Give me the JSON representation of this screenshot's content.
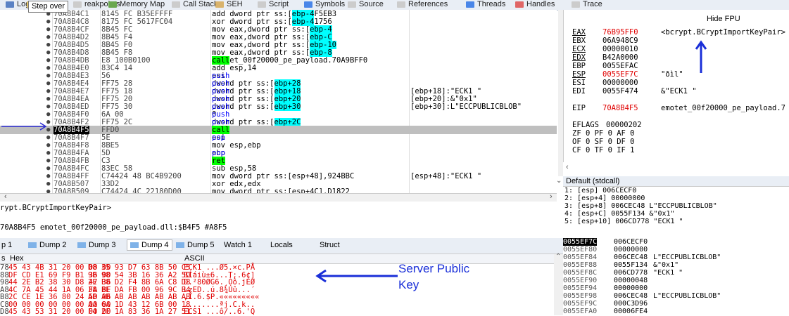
{
  "tabs": [
    {
      "label": "Log",
      "color": "#5b82c4"
    },
    {
      "label": "Not",
      "color": "#e3c46a"
    },
    {
      "label": "reakpoints",
      "color": "#cccccc"
    },
    {
      "label": "Memory Map",
      "color": "#6aa84f"
    },
    {
      "label": "Call Stack",
      "color": "#cccccc"
    },
    {
      "label": "SEH",
      "color": "#d9b36c"
    },
    {
      "label": "Script",
      "color": "#cccccc"
    },
    {
      "label": "Symbols",
      "color": "#4a86e8"
    },
    {
      "label": "Source",
      "color": "#cccccc"
    },
    {
      "label": "References",
      "color": "#cccccc"
    },
    {
      "label": "Threads",
      "color": "#4a86e8"
    },
    {
      "label": "Handles",
      "color": "#e06666"
    },
    {
      "label": "Trace",
      "color": "#cccccc"
    }
  ],
  "tooltip": "Step over",
  "disasm": [
    {
      "addr": "70A8B4C1",
      "bytes": "8145 FC B35EFFFF",
      "instr": "add dword ptr ss:[ebp-4],FFFF5EB3",
      "cmt": ""
    },
    {
      "addr": "70A8B4C8",
      "bytes": "8175 FC 5617FC04",
      "instr": "xor dword ptr ss:[ebp-4],4FC1756",
      "cmt": ""
    },
    {
      "addr": "70A8B4CF",
      "bytes": "8B45 FC",
      "instr": "mov eax,dword ptr ss:[ebp-4]",
      "cmt": ""
    },
    {
      "addr": "70A8B4D2",
      "bytes": "8B45 F4",
      "instr": "mov eax,dword ptr ss:[ebp-C]",
      "cmt": ""
    },
    {
      "addr": "70A8B4D5",
      "bytes": "8B45 F0",
      "instr": "mov eax,dword ptr ss:[ebp-10]",
      "cmt": ""
    },
    {
      "addr": "70A8B4D8",
      "bytes": "8B45 F8",
      "instr": "mov eax,dword ptr ss:[ebp-8]",
      "cmt": ""
    },
    {
      "addr": "70A8B4DB",
      "bytes": "E8 100B0100",
      "instr": "call emotet_00f20000_pe_payload.70A9BFF0",
      "cmt": ""
    },
    {
      "addr": "70A8B4E0",
      "bytes": "83C4 14",
      "instr": "add esp,14",
      "cmt": ""
    },
    {
      "addr": "70A8B4E3",
      "bytes": "56",
      "instr": "push esi",
      "cmt": ""
    },
    {
      "addr": "70A8B4E4",
      "bytes": "FF75 28",
      "instr": "push dword ptr ss:[ebp+28]",
      "cmt": ""
    },
    {
      "addr": "70A8B4E7",
      "bytes": "FF75 18",
      "instr": "push dword ptr ss:[ebp+18]",
      "cmt": "[ebp+18]:\"ECK1 \""
    },
    {
      "addr": "70A8B4EA",
      "bytes": "FF75 20",
      "instr": "push dword ptr ss:[ebp+20]",
      "cmt": "[ebp+20]:&\"0x1\""
    },
    {
      "addr": "70A8B4ED",
      "bytes": "FF75 30",
      "instr": "push dword ptr ss:[ebp+30]",
      "cmt": "[ebp+30]:L\"ECCPUBLICBLOB\""
    },
    {
      "addr": "70A8B4F0",
      "bytes": "6A 00",
      "instr": "push 0",
      "cmt": ""
    },
    {
      "addr": "70A8B4F2",
      "bytes": "FF75 2C",
      "instr": "push dword ptr ss:[ebp+2C]",
      "cmt": ""
    },
    {
      "addr": "70A8B4F5",
      "bytes": "FFD0",
      "instr": "call eax",
      "cmt": ""
    },
    {
      "addr": "70A8B4F7",
      "bytes": "5E",
      "instr": "pop esi",
      "cmt": ""
    },
    {
      "addr": "70A8B4F8",
      "bytes": "8BE5",
      "instr": "mov esp,ebp",
      "cmt": ""
    },
    {
      "addr": "70A8B4FA",
      "bytes": "5D",
      "instr": "pop ebp",
      "cmt": ""
    },
    {
      "addr": "70A8B4FB",
      "bytes": "C3",
      "instr": "ret",
      "cmt": ""
    },
    {
      "addr": "70A8B4FC",
      "bytes": "83EC 58",
      "instr": "sub esp,58",
      "cmt": ""
    },
    {
      "addr": "70A8B4FF",
      "bytes": "C74424 48 BC4B9200",
      "instr": "mov dword ptr ss:[esp+48],924BBC",
      "cmt": "[esp+48]:\"ECK1 \""
    },
    {
      "addr": "70A8B507",
      "bytes": "33D2",
      "instr": "xor edx,edx",
      "cmt": ""
    },
    {
      "addr": "70A8B509",
      "bytes": "C74424 4C 22180D00",
      "instr": "mov dword ptr ss:[esp+4C],D1822",
      "cmt": ""
    }
  ],
  "info_line1": "rypt.BCryptImportKeyPair>",
  "info_line2": "70A8B4F5 emotet_00f20000_pe_payload.dll:$B4F5 #A8F5",
  "registers": {
    "hide_fpu": "Hide FPU",
    "rows": [
      {
        "n": "EAX",
        "v": "76B95FF0",
        "c": "<bcrypt.BCryptImportKeyPair>"
      },
      {
        "n": "EBX",
        "v": "06A948C9",
        "c": ""
      },
      {
        "n": "ECX",
        "v": "00000010",
        "c": ""
      },
      {
        "n": "EDX",
        "v": "B42A0000",
        "c": ""
      },
      {
        "n": "EBP",
        "v": "0055EFAC",
        "c": ""
      },
      {
        "n": "ESP",
        "v": "0055EF7C",
        "c": "\"ðìl\""
      },
      {
        "n": "ESI",
        "v": "00000000",
        "c": ""
      },
      {
        "n": "EDI",
        "v": "0055F474",
        "c": "&\"ECK1 \""
      },
      {
        "n": "EIP",
        "v": "70A8B4F5",
        "c": "emotet_00f20000_pe_payload.7"
      },
      {
        "n": "EFLAGS",
        "v": "00000202",
        "c": ""
      },
      {
        "n": "ZF 0  PF 0  AF 0",
        "v": "",
        "c": ""
      },
      {
        "n": "OF 0  SF 0  DF 0",
        "v": "",
        "c": ""
      },
      {
        "n": "CF 0  TF 0  IF 1",
        "v": "",
        "c": ""
      }
    ]
  },
  "default_call": "Default (stdcall)",
  "args": [
    "1: [esp] 006CECF0",
    "2: [esp+4] 00000000",
    "3: [esp+8] 006CEC48 L\"ECCPUBLICBLOB\"",
    "4: [esp+C] 0055F134 &\"0x1\"",
    "5: [esp+10] 006CD778 \"ECK1 \""
  ],
  "dump_tabs": [
    "p 1",
    "Dump 2",
    "Dump 3",
    "Dump 4",
    "Dump 5",
    "Watch 1",
    "Locals",
    "Struct"
  ],
  "dump_header": {
    "left": "s",
    "hex": "Hex",
    "ascii": "ASCII"
  },
  "dump_rows": [
    {
      "l": "78",
      "h1": "45 43 4B 31 20 00 00 00",
      "h2": "D8 35 93 D7 63 8B 50 C5",
      "a": "ECK1 ...Ø5.×c.PÅ"
    },
    {
      "l": "88",
      "h1": "DF CD E1 69 F9 B1 36 00",
      "h2": "9B 98 54 3B 16 36 A2 5D",
      "a": "ßÍáiù±6...T;.6¢]"
    },
    {
      "l": "98",
      "h1": "44 2E B2 38 30 D8 47 36",
      "h2": "2E B8 D2 F4 8B 6A C8 D8",
      "a": "D.²80ØG6.¸Òô.jÈØ"
    },
    {
      "l": "A8",
      "h1": "4C 7A 45 44 1A 06 FA 8F",
      "h2": "38 BE DA FB 00 96 9C B4",
      "a": "LzED..ú.8¾Úû...´"
    },
    {
      "l": "B8",
      "h1": "2C CE 1E 36 80 24 50 96",
      "h2": "AB AB AB AB AB AB AB AB",
      "a": ",Î.6.$P.«««««««««"
    },
    {
      "l": "C8",
      "h1": "00 00 00 00 00 00 00 00",
      "h2": "AA 6A 1D 43 12 6B 00 18",
      "a": "........ªj.C.k.."
    },
    {
      "l": "D8",
      "h1": "45 43 53 31 20 00 00 00",
      "h2": "F4 2F 1A 83 36 1A 27 51",
      "a": "ECS1 ...ô/..6.'Q"
    }
  ],
  "annotation": {
    "line1": "Server Public",
    "line2": "Key",
    "color": "#1a2fd8"
  },
  "stack": [
    {
      "a": "0055EF7C",
      "v": "006CECF0",
      "c": ""
    },
    {
      "a": "0055EF80",
      "v": "00000000",
      "c": ""
    },
    {
      "a": "0055EF84",
      "v": "006CEC48",
      "c": "L\"ECCPUBLICBLOB\""
    },
    {
      "a": "0055EF88",
      "v": "0055F134",
      "c": "&\"0x1\""
    },
    {
      "a": "0055EF8C",
      "v": "006CD778",
      "c": "\"ECK1 \""
    },
    {
      "a": "0055EF90",
      "v": "00000048",
      "c": ""
    },
    {
      "a": "0055EF94",
      "v": "00000000",
      "c": ""
    },
    {
      "a": "0055EF98",
      "v": "006CEC48",
      "c": "L\"ECCPUBLICBLOB\""
    },
    {
      "a": "0055EF9C",
      "v": "000C3D96",
      "c": ""
    },
    {
      "a": "0055EFA0",
      "v": "00006FE4",
      "c": ""
    }
  ]
}
